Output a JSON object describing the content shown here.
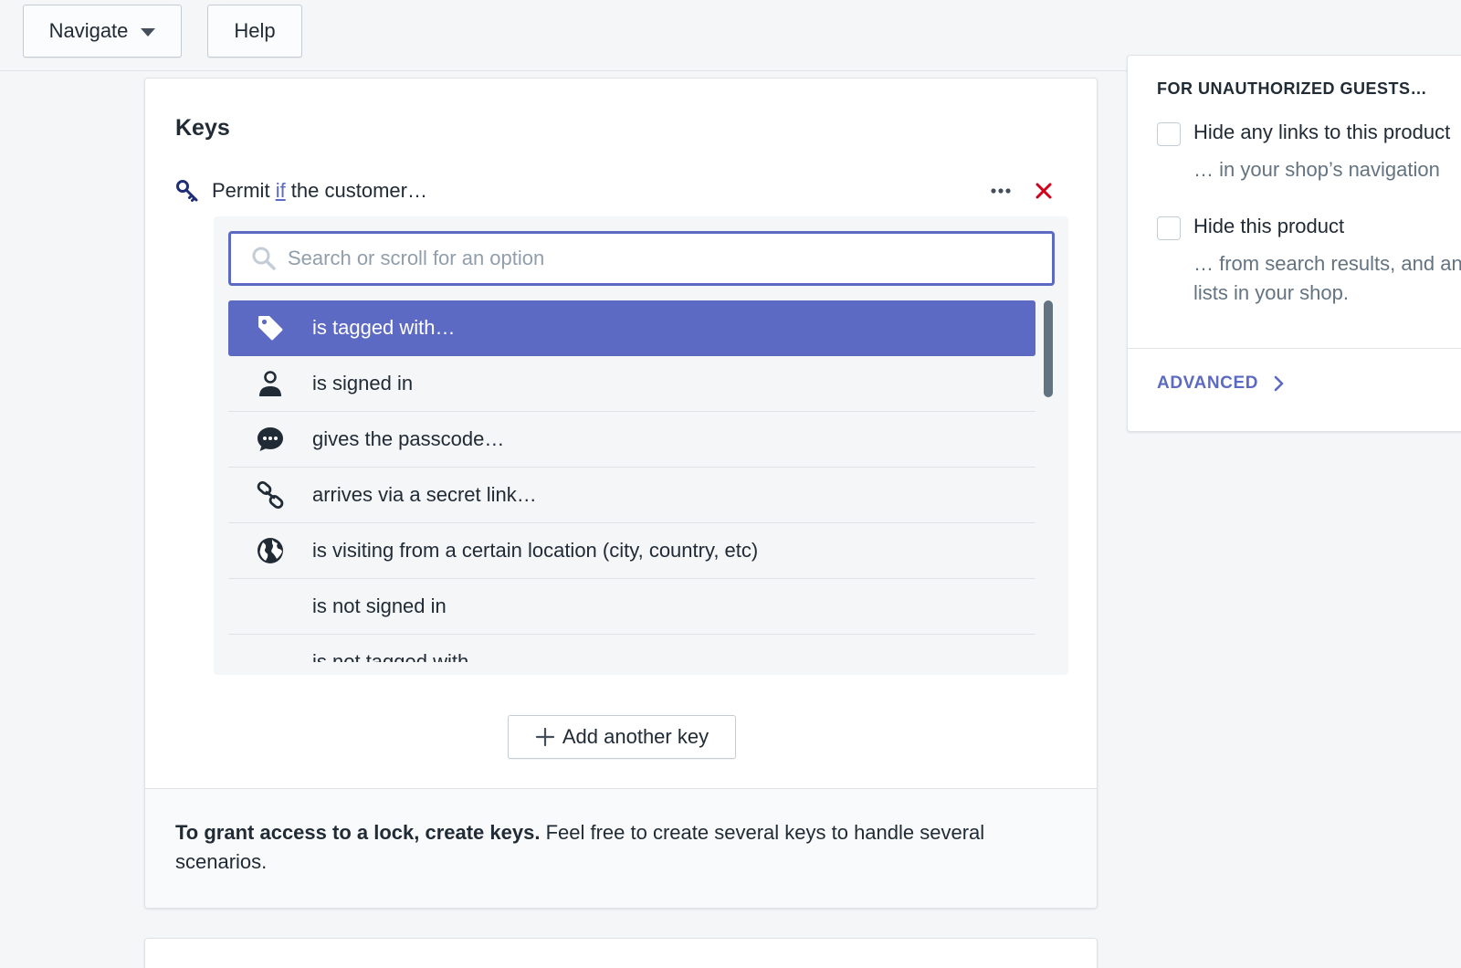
{
  "topbar": {
    "navigate_label": "Navigate",
    "help_label": "Help"
  },
  "keys_card": {
    "title": "Keys",
    "key": {
      "prefix": "Permit ",
      "link": "if",
      "suffix": " the customer…"
    },
    "search": {
      "placeholder": "Search or scroll for an option",
      "value": ""
    },
    "options": [
      {
        "label": "is tagged with…",
        "icon": "tag-icon",
        "selected": true
      },
      {
        "label": "is signed in",
        "icon": "person-icon",
        "selected": false
      },
      {
        "label": "gives the passcode…",
        "icon": "chat-bubble-icon",
        "selected": false
      },
      {
        "label": "arrives via a secret link…",
        "icon": "link-icon",
        "selected": false
      },
      {
        "label": "is visiting from a certain location (city, country, etc)",
        "icon": "globe-icon",
        "selected": false
      },
      {
        "label": "is not signed in",
        "icon": "",
        "selected": false
      },
      {
        "label": "is not tagged with…",
        "icon": "",
        "selected": false
      }
    ],
    "add_key_label": "Add another key",
    "footer": {
      "bold": "To grant access to a lock, create keys.",
      "rest": " Feel free to create several keys to handle several scenarios."
    }
  },
  "guests_card": {
    "heading": "FOR UNAUTHORIZED GUESTS…",
    "options": [
      {
        "label": "Hide any links to this product",
        "help": "… in your shop’s navigation",
        "checked": false
      },
      {
        "label": "Hide this product",
        "help": "… from search results, and any lists in your shop.",
        "checked": false
      }
    ],
    "advanced_label": "ADVANCED"
  },
  "colors": {
    "accent": "#5c6ac4",
    "danger": "#d0021b",
    "text": "#212b36",
    "subdued": "#637381"
  }
}
